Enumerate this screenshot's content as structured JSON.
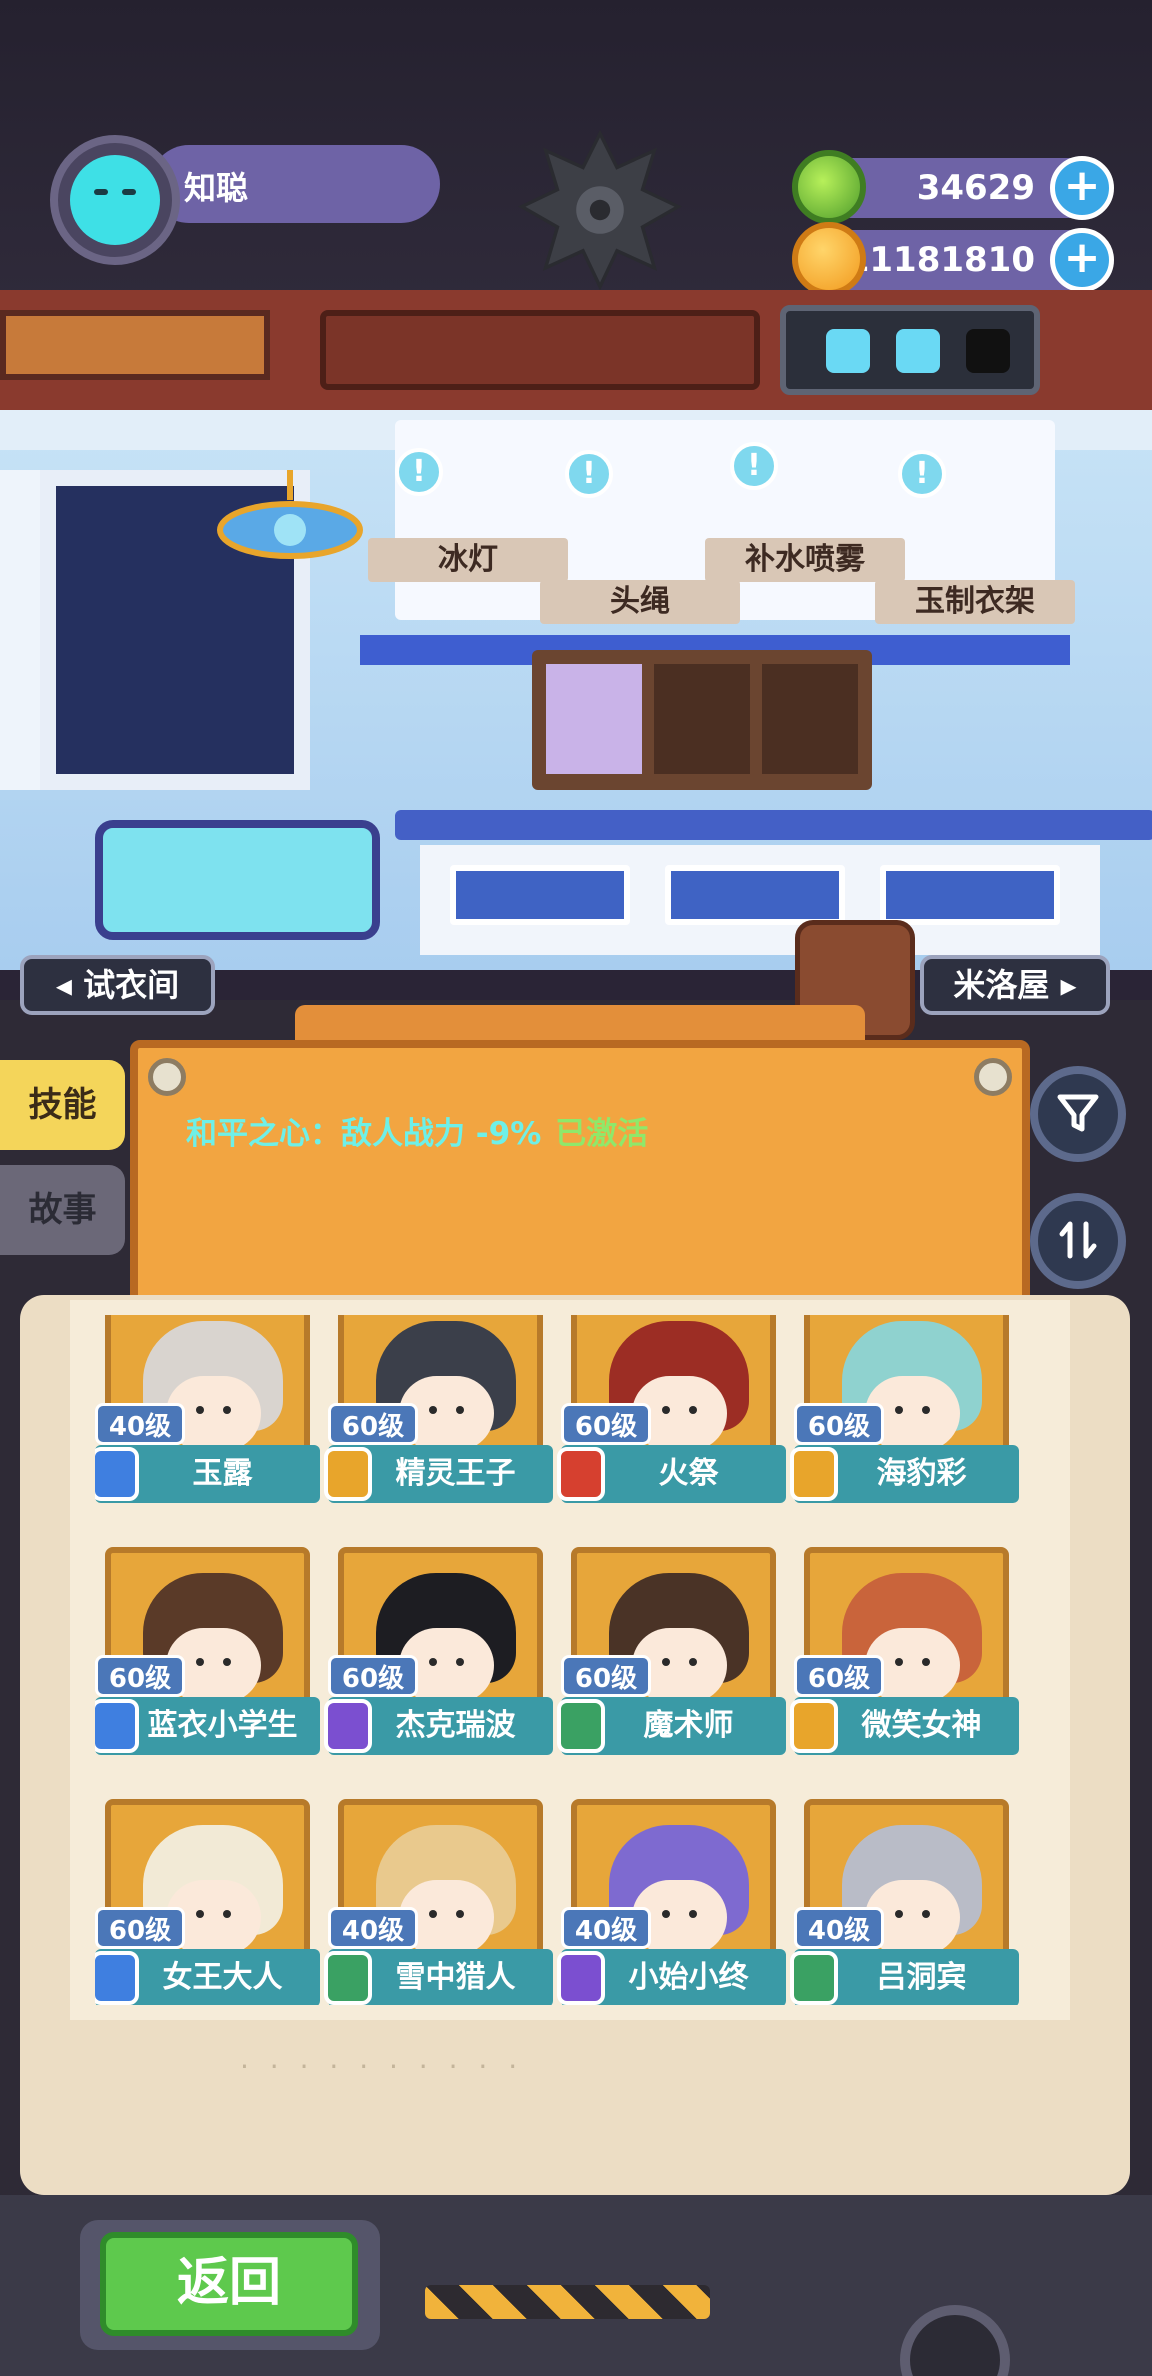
{
  "player": {
    "name": "知聪"
  },
  "resources": [
    {
      "value": "34629",
      "icon": "leaf-coin-icon"
    },
    {
      "value": "11181810",
      "icon": "gold-planet-icon"
    }
  ],
  "room_items": {
    "ice_lamp": "冰灯",
    "hair_band": "头绳",
    "mist_spray": "补水喷雾",
    "jade_hanger": "玉制衣架",
    "bubble_mark": "!"
  },
  "nav": {
    "fitting_room": "试衣间",
    "mini_house": "米洛屋"
  },
  "tabs": {
    "skills": "技能",
    "story": "故事"
  },
  "skill": {
    "text": "和平之心：敌人战力 -9%",
    "status": "已激活"
  },
  "colors": {
    "skill_text": "#6ef0e8",
    "active": "#8fe86a",
    "back_button": "#5ec94d"
  },
  "characters": [
    {
      "name": "玉露",
      "level": "40级",
      "rank": "blue",
      "hair": "#d9d4cf"
    },
    {
      "name": "精灵王子",
      "level": "60级",
      "rank": "orange",
      "hair": "#3b3f4a"
    },
    {
      "name": "火祭",
      "level": "60级",
      "rank": "red",
      "hair": "#9c2d24"
    },
    {
      "name": "海豹彩",
      "level": "60级",
      "rank": "orange",
      "hair": "#8fd2cf"
    },
    {
      "name": "蓝衣小学生",
      "level": "60级",
      "rank": "blue",
      "hair": "#5a3a28"
    },
    {
      "name": "杰克瑞波",
      "level": "60级",
      "rank": "purple",
      "hair": "#1d1d22"
    },
    {
      "name": "魔术师",
      "level": "60级",
      "rank": "green",
      "hair": "#4a3326"
    },
    {
      "name": "微笑女神",
      "level": "60级",
      "rank": "orange",
      "hair": "#c9643b"
    },
    {
      "name": "女王大人",
      "level": "60级",
      "rank": "blue",
      "hair": "#f2ead6"
    },
    {
      "name": "雪中猎人",
      "level": "40级",
      "rank": "green",
      "hair": "#e9c98d"
    },
    {
      "name": "小始小终",
      "level": "40级",
      "rank": "purple",
      "hair": "#7e6ad0"
    },
    {
      "name": "吕洞宾",
      "level": "40级",
      "rank": "green",
      "hair": "#b9bcc7"
    }
  ],
  "rank_colors": {
    "blue": "#3f7fe0",
    "orange": "#e8a52b",
    "red": "#d6402f",
    "purple": "#7b4fd0",
    "green": "#3aa163"
  },
  "back_button": "返回"
}
